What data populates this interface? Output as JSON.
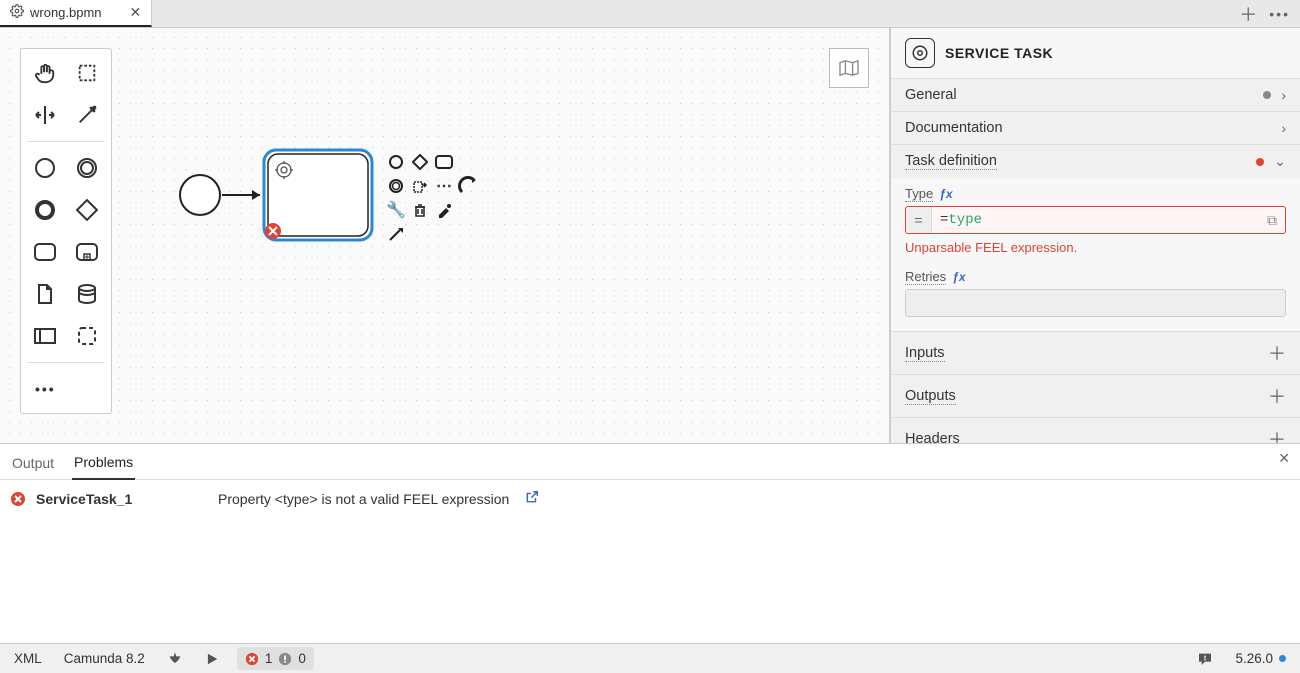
{
  "tab": {
    "title": "wrong.bpmn"
  },
  "panel": {
    "title": "SERVICE TASK",
    "sections": {
      "general": "General",
      "documentation": "Documentation",
      "task_def": "Task definition",
      "inputs": "Inputs",
      "outputs": "Outputs",
      "headers": "Headers"
    },
    "task_def_fields": {
      "type_label": "Type",
      "type_value": "=type",
      "type_error": "Unparsable FEEL expression.",
      "retries_label": "Retries"
    }
  },
  "bottom": {
    "tabs": {
      "output": "Output",
      "problems": "Problems"
    },
    "problem": {
      "id": "ServiceTask_1",
      "message": "Property <type> is not a valid FEEL expression"
    }
  },
  "status": {
    "xml": "XML",
    "platform": "Camunda 8.2",
    "errors": "1",
    "warnings": "0",
    "version": "5.26.0"
  }
}
